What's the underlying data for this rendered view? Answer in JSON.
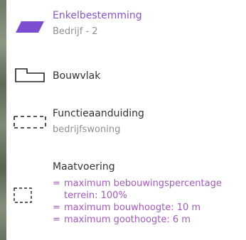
{
  "colors": {
    "accent": "#8856c9",
    "list_text": "#a25ab8",
    "muted": "#8f8f8f",
    "text": "#333333"
  },
  "legend": {
    "enkelbestemming": {
      "title": "Enkelbestemming",
      "subtitle": "Bedrijf - 2",
      "swatch_color": "#7b4ed1"
    },
    "bouwvlak": {
      "title": "Bouwvlak"
    },
    "functieaanduiding": {
      "title": "Functieaanduiding",
      "subtitle": "bedrijfswoning"
    },
    "maatvoering": {
      "title": "Maatvoering",
      "items": [
        {
          "bullet": "=",
          "line1": "maximum bebouwingspercentage",
          "line2": "terrein: 100%"
        },
        {
          "bullet": "=",
          "line1": "maximum bouwhoogte: 10 m"
        },
        {
          "bullet": "=",
          "line1": "maximum goothoogte: 6 m"
        }
      ]
    }
  }
}
